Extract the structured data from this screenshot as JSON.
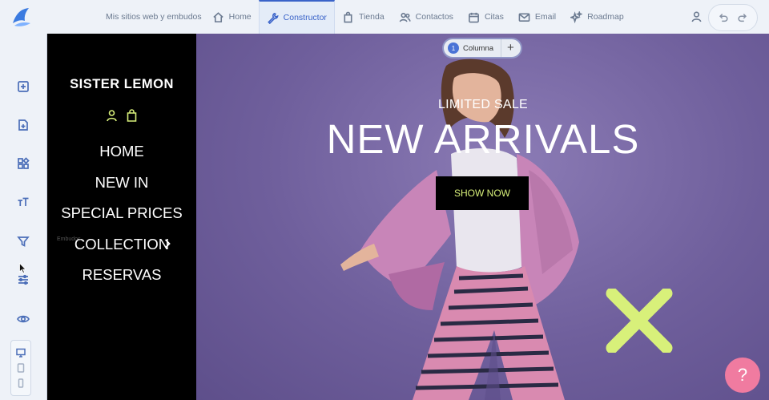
{
  "app": {
    "nav": [
      {
        "label": "Mis sitios web y embudos",
        "icon": "none"
      },
      {
        "label": "Home",
        "icon": "home-icon"
      },
      {
        "label": "Constructor",
        "icon": "wrench-icon",
        "active": true
      },
      {
        "label": "Tienda",
        "icon": "shopping-bag-icon"
      },
      {
        "label": "Contactos",
        "icon": "contacts-icon"
      },
      {
        "label": "Citas",
        "icon": "calendar-icon"
      },
      {
        "label": "Email",
        "icon": "mail-icon"
      },
      {
        "label": "Roadmap",
        "icon": "sparkle-icon"
      }
    ],
    "accent_color": "#3a63c9"
  },
  "sidebar": {
    "tools": [
      "add-section-icon",
      "add-element-icon",
      "widgets-icon",
      "typography-icon",
      "funnel-icon",
      "settings-sliders-icon",
      "preview-eye-icon"
    ],
    "devices": [
      "desktop-icon",
      "tablet-icon",
      "mobile-icon"
    ]
  },
  "canvas": {
    "column_pill": {
      "number": "1",
      "label": "Columna",
      "add": "+"
    },
    "store": {
      "brand": "SISTER LEMON",
      "menu": [
        "HOME",
        "NEW IN",
        "SPECIAL PRICES",
        "COLLECTION",
        "RESERVAS"
      ],
      "ghost_label": "Embudos"
    },
    "hero": {
      "subtitle": "LIMITED SALE",
      "title": "NEW ARRIVALS",
      "button": "SHOW NOW",
      "accent": "#d8f07a"
    },
    "help": "?"
  }
}
